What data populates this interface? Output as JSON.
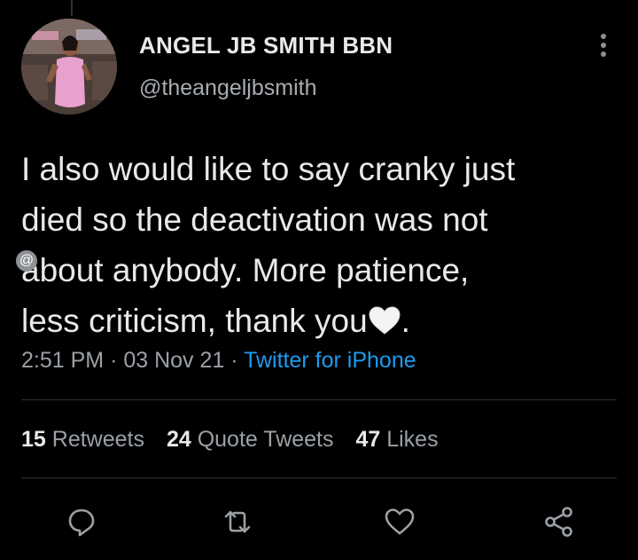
{
  "author": {
    "display_name": "ANGEL JB SMITH BBN",
    "handle": "@theangeljbsmith"
  },
  "tweet": {
    "lines": [
      "I also would like to say cranky just",
      "died so the deactivation was not",
      "about anybody. More patience,",
      "less criticism, thank you"
    ],
    "emoji": "white-heart",
    "final_punct": ".",
    "time": "2:51 PM",
    "date": "03 Nov 21",
    "separator": "·",
    "source": "Twitter for iPhone"
  },
  "stats": {
    "retweets_count": "15",
    "retweets_label": "Retweets",
    "quotes_count": "24",
    "quotes_label": "Quote Tweets",
    "likes_count": "47",
    "likes_label": "Likes"
  },
  "icons": {
    "more": "more-vertical-icon",
    "reply": "reply-icon",
    "retweet": "retweet-icon",
    "like": "heart-icon",
    "share": "share-icon"
  },
  "colors": {
    "background": "#000000",
    "text": "#e7e9ea",
    "muted": "#9aa0a6",
    "link": "#1d9bf0",
    "divider": "#2f3336"
  }
}
